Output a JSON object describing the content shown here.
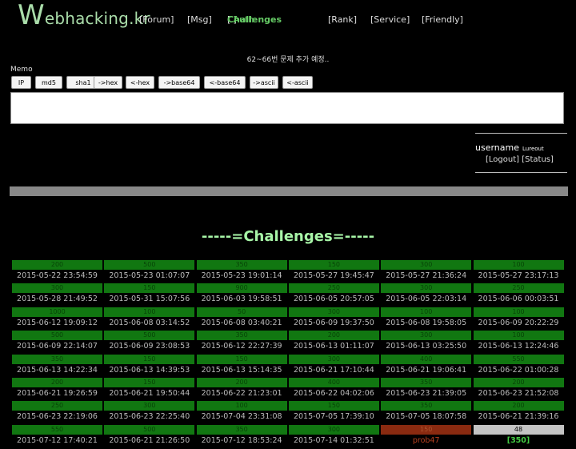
{
  "logo": {
    "first_letter": "W",
    "rest": "ebhacking.kr"
  },
  "nav": {
    "forum": "[Forum]",
    "msg": "[Msg]",
    "challenges_open": "[",
    "challenges": "Challenges",
    "sep": " - ",
    "auth": "Auth",
    "challenges_close": "]",
    "rank": "[Rank]",
    "service": "[Service]",
    "friendly": "[Friendly]"
  },
  "notice": "62~66번 문제 추가 예정..",
  "memo": {
    "label": "Memo",
    "buttons": [
      "IP",
      "md5",
      "sha1",
      "->hex",
      "<-hex",
      "->base64",
      "<-base64",
      "->ascii",
      "<-ascii"
    ],
    "value": ""
  },
  "login": {
    "label": "username",
    "value": "Lureout",
    "logout": "[Logout]",
    "status": "[Status]"
  },
  "heading": "-----=Challenges=-----",
  "challenges": [
    [
      {
        "score": "200",
        "date": "2015-05-22 23:54:59"
      },
      {
        "score": "500",
        "date": "2015-05-23 01:07:07"
      },
      {
        "score": "350",
        "date": "2015-05-23 19:01:14"
      },
      {
        "score": "150",
        "date": "2015-05-27 19:45:47"
      },
      {
        "score": "300",
        "date": "2015-05-27 21:36:24"
      },
      {
        "score": "100",
        "date": "2015-05-27 23:17:13"
      }
    ],
    [
      {
        "score": "300",
        "date": "2015-05-28 21:49:52"
      },
      {
        "score": "150",
        "date": "2015-05-31 15:07:56"
      },
      {
        "score": "900",
        "date": "2015-06-03 19:58:51"
      },
      {
        "score": "250",
        "date": "2015-06-05 20:57:05"
      },
      {
        "score": "300",
        "date": "2015-06-05 22:03:14"
      },
      {
        "score": "250",
        "date": "2015-06-06 00:03:51"
      }
    ],
    [
      {
        "score": "1000",
        "date": "2015-06-12 19:09:12"
      },
      {
        "score": "100",
        "date": "2015-06-08 03:14:52"
      },
      {
        "score": "50",
        "date": "2015-06-08 03:40:21"
      },
      {
        "score": "300",
        "date": "2015-06-09 19:37:50"
      },
      {
        "score": "100",
        "date": "2015-06-08 19:58:05"
      },
      {
        "score": "100",
        "date": "2015-06-09 20:22:29"
      }
    ],
    [
      {
        "score": "500",
        "date": "2015-06-09 22:14:07"
      },
      {
        "score": "500",
        "date": "2015-06-09 23:08:53"
      },
      {
        "score": "350",
        "date": "2015-06-12 22:27:39"
      },
      {
        "score": "200",
        "date": "2015-06-13 01:11:07"
      },
      {
        "score": "300",
        "date": "2015-06-13 03:25:50"
      },
      {
        "score": "100",
        "date": "2015-06-13 12:24:46"
      }
    ],
    [
      {
        "score": "350",
        "date": "2015-06-13 14:22:34"
      },
      {
        "score": "150",
        "date": "2015-06-13 14:39:53"
      },
      {
        "score": "150",
        "date": "2015-06-13 15:14:35"
      },
      {
        "score": "300",
        "date": "2015-06-21 17:10:44"
      },
      {
        "score": "400",
        "date": "2015-06-21 19:06:41"
      },
      {
        "score": "550",
        "date": "2015-06-22 01:00:28"
      }
    ],
    [
      {
        "score": "200",
        "date": "2015-06-21 19:26:59"
      },
      {
        "score": "150",
        "date": "2015-06-21 19:50:44"
      },
      {
        "score": "200",
        "date": "2015-06-22 21:23:01"
      },
      {
        "score": "400",
        "date": "2015-06-22 04:02:06"
      },
      {
        "score": "350",
        "date": "2015-06-23 21:39:05"
      },
      {
        "score": "200",
        "date": "2015-06-23 21:52:08"
      }
    ],
    [
      {
        "score": "250",
        "date": "2015-06-23 22:19:06"
      },
      {
        "score": "300",
        "date": "2015-06-23 22:25:40"
      },
      {
        "score": "100",
        "date": "2015-07-04 23:31:08"
      },
      {
        "score": "150",
        "date": "2015-07-05 17:39:10"
      },
      {
        "score": "350",
        "date": "2015-07-05 18:07:58"
      },
      {
        "score": "200",
        "date": "2015-06-21 21:39:16"
      }
    ],
    [
      {
        "score": "550",
        "date": "2015-07-12 17:40:21"
      },
      {
        "score": "500",
        "date": "2015-06-21 21:26:50"
      },
      {
        "score": "350",
        "date": "2015-07-12 18:53:24"
      },
      {
        "score": "300",
        "date": "2015-07-14 01:32:51"
      },
      {
        "score": "150",
        "date": "prob47",
        "status": "red"
      },
      {
        "score": "48",
        "date": "[350]",
        "status": "grey"
      }
    ]
  ],
  "colors": {
    "bg": "#000000",
    "cell_green": "#117711",
    "unsolved_red": "#8a2a10",
    "heading": "#a7f5a7"
  }
}
